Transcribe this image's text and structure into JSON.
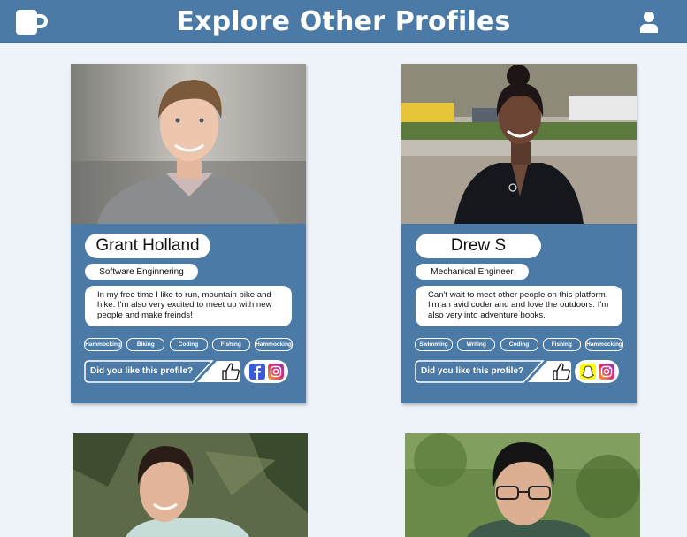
{
  "header": {
    "title": "Explore Other Profiles"
  },
  "like_prompt": "Did you like this profile?",
  "colors": {
    "primary": "#4a7aa5",
    "background": "#eef2f9"
  },
  "profiles": [
    {
      "name": "Grant Holland",
      "job": "Software Enginnering",
      "bio": "In my free time I like to run, mountain bike and hike. I'm also very excited to meet up with new people and make freinds!",
      "tags": [
        "Hammocking",
        "Biking",
        "Coding",
        "Fishing",
        "Hammocking"
      ],
      "socials": [
        "facebook-icon",
        "instagram-icon"
      ]
    },
    {
      "name": "Drew S",
      "job": "Mechanical Engineer",
      "bio": "Can't wait to meet other people on this platform. I'm an avid coder and and love the outdoors. I'm also very into adventure books.",
      "tags": [
        "Swimming",
        "Writing",
        "Coding",
        "Fishing",
        "Hammocking"
      ],
      "socials": [
        "snapchat-icon",
        "instagram-icon"
      ]
    }
  ]
}
